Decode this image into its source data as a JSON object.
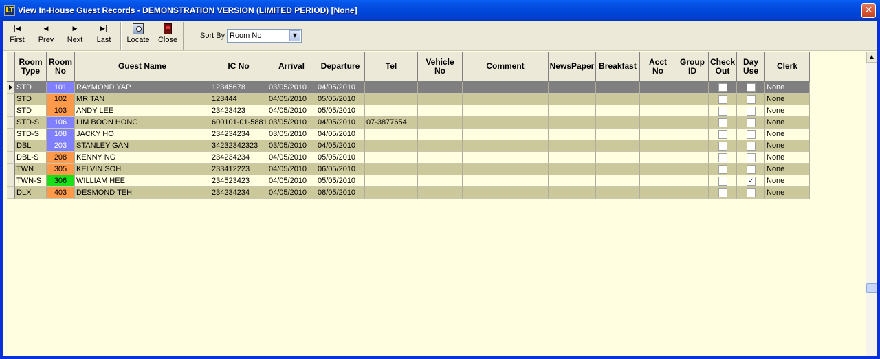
{
  "window": {
    "title": "View In-House Guest Records - DEMONSTRATION VERSION (LIMITED PERIOD) [None]",
    "app_icon_text": "LT",
    "close_glyph": "✕"
  },
  "toolbar": {
    "first": {
      "label": "First",
      "icon": "first-record-icon",
      "glyph": "|◀"
    },
    "prev": {
      "label": "Prev",
      "icon": "previous-icon",
      "glyph": "◀"
    },
    "next": {
      "label": "Next",
      "icon": "next-icon",
      "glyph": "▶"
    },
    "last": {
      "label": "Last",
      "icon": "last-record-icon",
      "glyph": "▶|"
    },
    "locate": {
      "label": "Locate",
      "icon": "locate-icon"
    },
    "close": {
      "label": "Close",
      "icon": "door-close-icon"
    },
    "sort_by_label": "Sort By",
    "sort_by_value": "Room No",
    "dropdown_glyph": "▼"
  },
  "columns": [
    "Room\nType",
    "Room\nNo",
    "Guest Name",
    "IC No",
    "Arrival",
    "Departure",
    "Tel",
    "Vehicle\nNo",
    "Comment",
    "NewsPaper",
    "Breakfast",
    "Acct\nNo",
    "Group\nID",
    "Check\nOut",
    "Day\nUse",
    "Clerk"
  ],
  "colors": {
    "room_blue": "#8080ff",
    "room_orange": "#ff9a4a",
    "room_green": "#19e019",
    "row_odd": "#fffee0",
    "row_even": "#cbc89b",
    "row_selected": "#7f7f7f"
  },
  "rows": [
    {
      "room_type": "STD",
      "room_no": "101",
      "room_color": "blue",
      "guest": "RAYMOND YAP",
      "ic": "12345678",
      "arrival": "03/05/2010",
      "departure": "04/05/2010",
      "tel": "",
      "check_out": false,
      "day_use": false,
      "clerk": "None",
      "selected": true
    },
    {
      "room_type": "STD",
      "room_no": "102",
      "room_color": "orange",
      "guest": "MR TAN",
      "ic": "123444",
      "arrival": "04/05/2010",
      "departure": "05/05/2010",
      "tel": "",
      "check_out": false,
      "day_use": false,
      "clerk": "None"
    },
    {
      "room_type": "STD",
      "room_no": "103",
      "room_color": "orange",
      "guest": "ANDY LEE",
      "ic": "23423423",
      "arrival": "04/05/2010",
      "departure": "05/05/2010",
      "tel": "",
      "check_out": false,
      "day_use": false,
      "clerk": "None"
    },
    {
      "room_type": "STD-S",
      "room_no": "106",
      "room_color": "blue",
      "guest": "LIM BOON HONG",
      "ic": "600101-01-5881",
      "arrival": "03/05/2010",
      "departure": "04/05/2010",
      "tel": "07-3877654",
      "check_out": false,
      "day_use": false,
      "clerk": "None"
    },
    {
      "room_type": "STD-S",
      "room_no": "108",
      "room_color": "blue",
      "guest": "JACKY HO",
      "ic": "234234234",
      "arrival": "03/05/2010",
      "departure": "04/05/2010",
      "tel": "",
      "check_out": false,
      "day_use": false,
      "clerk": "None"
    },
    {
      "room_type": "DBL",
      "room_no": "203",
      "room_color": "blue",
      "guest": "STANLEY GAN",
      "ic": "34232342323",
      "arrival": "03/05/2010",
      "departure": "04/05/2010",
      "tel": "",
      "check_out": false,
      "day_use": false,
      "clerk": "None"
    },
    {
      "room_type": "DBL-S",
      "room_no": "208",
      "room_color": "orange",
      "guest": "KENNY NG",
      "ic": "234234234",
      "arrival": "04/05/2010",
      "departure": "05/05/2010",
      "tel": "",
      "check_out": false,
      "day_use": false,
      "clerk": "None"
    },
    {
      "room_type": "TWN",
      "room_no": "305",
      "room_color": "orange",
      "guest": "KELVIN SOH",
      "ic": "233412223",
      "arrival": "04/05/2010",
      "departure": "06/05/2010",
      "tel": "",
      "check_out": false,
      "day_use": false,
      "clerk": "None"
    },
    {
      "room_type": "TWN-S",
      "room_no": "306",
      "room_color": "green",
      "guest": "WILLIAM HEE",
      "ic": "234523423",
      "arrival": "04/05/2010",
      "departure": "05/05/2010",
      "tel": "",
      "check_out": false,
      "day_use": true,
      "clerk": "None"
    },
    {
      "room_type": "DLX",
      "room_no": "403",
      "room_color": "orange",
      "guest": "DESMOND TEH",
      "ic": "234234234",
      "arrival": "04/05/2010",
      "departure": "08/05/2010",
      "tel": "",
      "check_out": false,
      "day_use": false,
      "clerk": "None"
    }
  ],
  "scrollbar": {
    "up_glyph": "▲"
  }
}
